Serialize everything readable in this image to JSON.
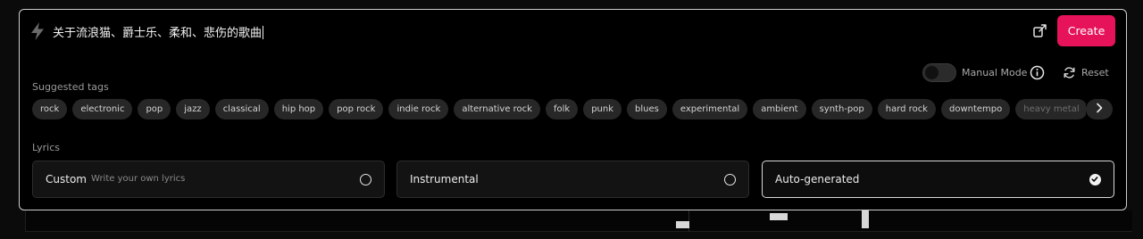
{
  "prompt": {
    "text": "关于流浪猫、爵士乐、柔和、悲伤的歌曲",
    "create_label": "Create"
  },
  "controls": {
    "manual_mode_label": "Manual Mode",
    "manual_mode_on": false,
    "reset_label": "Reset"
  },
  "tags": {
    "heading": "Suggested tags",
    "items": [
      "rock",
      "electronic",
      "pop",
      "jazz",
      "classical",
      "hip hop",
      "pop rock",
      "indie rock",
      "alternative rock",
      "folk",
      "punk",
      "blues",
      "experimental",
      "ambient",
      "synth-pop",
      "hard rock",
      "downtempo",
      "heavy metal"
    ]
  },
  "lyrics": {
    "heading": "Lyrics",
    "options": [
      {
        "label": "Custom",
        "sublabel": "Write your own lyrics",
        "selected": false
      },
      {
        "label": "Instrumental",
        "selected": false
      },
      {
        "label": "Auto-generated",
        "selected": true
      }
    ]
  },
  "icons": {
    "prompt": "bolt-icon",
    "share": "share-icon",
    "info": "info-icon",
    "reset": "refresh-icon",
    "tags_next": "chevron-right-icon",
    "selected_option": "check-icon"
  },
  "colors": {
    "accent": "#e6135a",
    "panel_border": "#cfcfcf",
    "tag_bg": "#272727"
  }
}
